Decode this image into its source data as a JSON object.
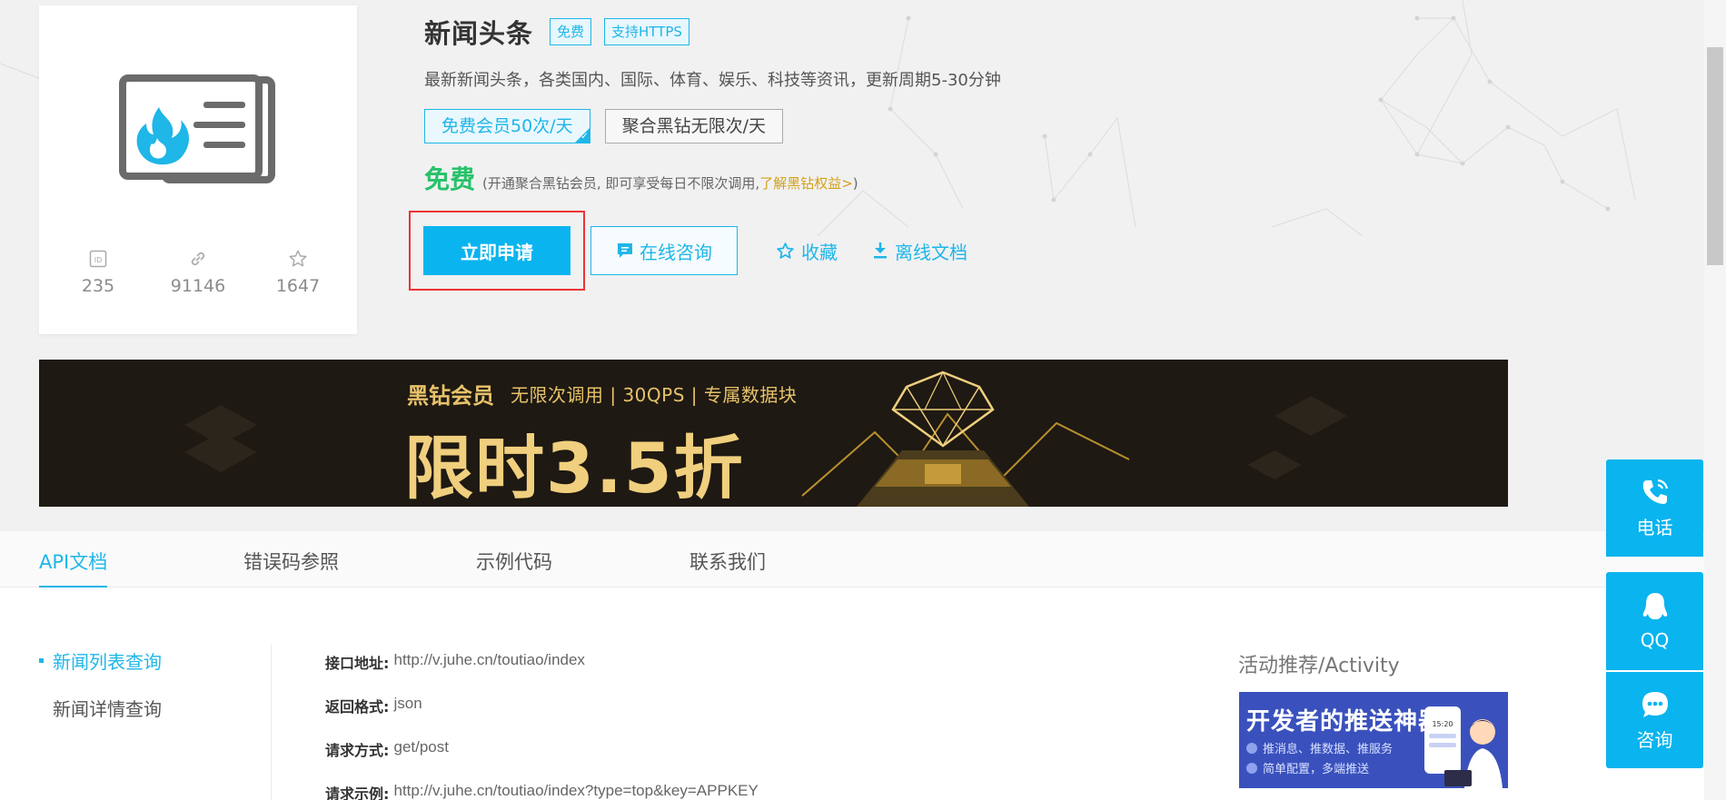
{
  "api": {
    "title": "新闻头条",
    "tag_free": "免费",
    "tag_https": "支持HTTPS",
    "description": "最新新闻头条，各类国内、国际、体育、娱乐、科技等资讯，更新周期5-30分钟",
    "plan_free": "免费会员50次/天",
    "plan_black": "聚合黑钻无限次/天",
    "price": "免费",
    "price_note_prefix": "(开通聚合黑钻会员, 即可享受每日不限次调用,",
    "price_note_link": "了解黑钻权益>",
    "price_note_suffix": ")",
    "stats": {
      "id": "235",
      "calls": "91146",
      "favorites": "1647"
    }
  },
  "actions": {
    "apply": "立即申请",
    "consult": "在线咨询",
    "favorite": "收藏",
    "offline_doc": "离线文档"
  },
  "banner": {
    "brand": "黑钻会员",
    "features": "无限次调用 | 30QPS | 专属数据块",
    "headline": "限时3.5折"
  },
  "tabs": [
    "API文档",
    "错误码参照",
    "示例代码",
    "联系我们"
  ],
  "sidebar": [
    "新闻列表查询",
    "新闻详情查询"
  ],
  "doc": {
    "endpoint_label": "接口地址:",
    "endpoint_value": "http://v.juhe.cn/toutiao/index",
    "format_label": "返回格式:",
    "format_value": "json",
    "method_label": "请求方式:",
    "method_value": "get/post",
    "example_label": "请求示例:",
    "example_value": "http://v.juhe.cn/toutiao/index?type=top&key=APPKEY"
  },
  "activity": {
    "title": "活动推荐/Activity",
    "headline": "开发者的推送神器",
    "line1": "推消息、推数据、推服务",
    "line2": "简单配置，多端推送",
    "phone_time": "15:20"
  },
  "float": {
    "phone": "电话",
    "qq": "QQ",
    "consult": "咨询"
  },
  "colors": {
    "accent": "#0ab4ef",
    "price_green": "#27c26a",
    "gold": "#e8c26a",
    "highlight_red": "#e33333"
  }
}
